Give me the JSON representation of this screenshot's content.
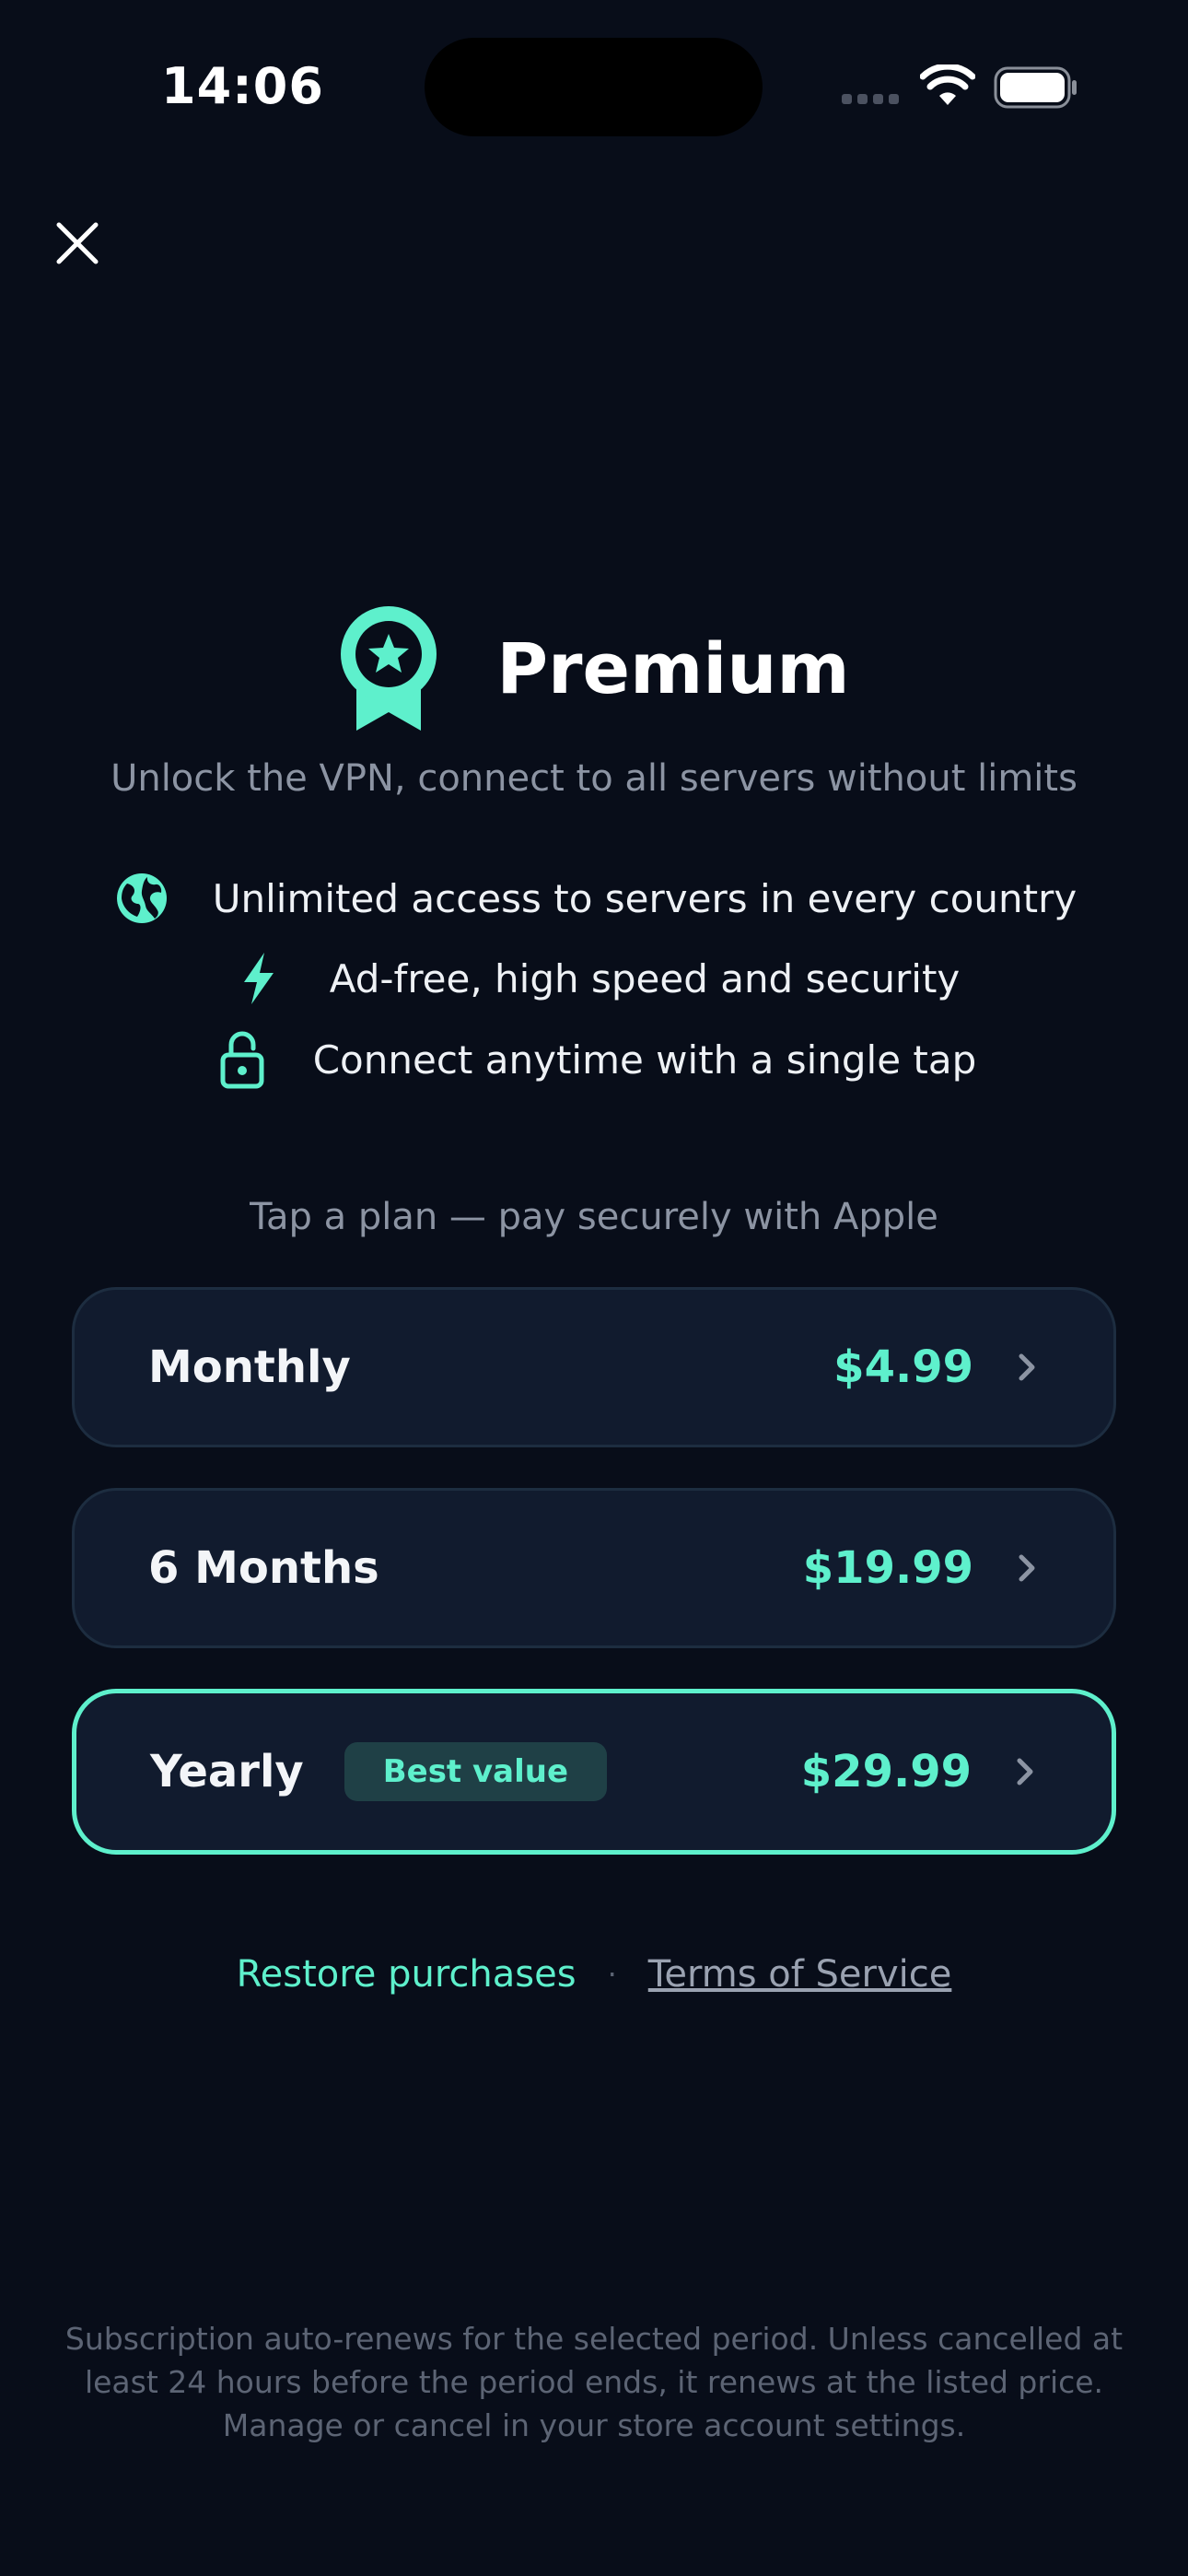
{
  "status_bar": {
    "time": "14:06"
  },
  "header": {
    "title": "Premium",
    "subtitle": "Unlock the VPN, connect to all servers without limits"
  },
  "features": [
    {
      "icon": "globe-icon",
      "text": "Unlimited access to servers in every country"
    },
    {
      "icon": "lightning-icon",
      "text": "Ad-free, high speed and security"
    },
    {
      "icon": "unlock-icon",
      "text": "Connect anytime with a single tap"
    }
  ],
  "plan_hint": "Tap a plan — pay securely with Apple",
  "plans": [
    {
      "name": "Monthly",
      "price": "$4.99",
      "badge": ""
    },
    {
      "name": "6 Months",
      "price": "$19.99",
      "badge": ""
    },
    {
      "name": "Yearly",
      "price": "$29.99",
      "badge": "Best value"
    }
  ],
  "links": {
    "restore": "Restore purchases",
    "separator": "·",
    "terms": "Terms of Service"
  },
  "legal": "Subscription auto-renews for the selected period. Unless cancelled at least 24 hours before the period ends, it renews at the listed price. Manage or cancel in your store account settings.",
  "colors": {
    "background": "#080d19",
    "accent": "#5ef0cc",
    "card": "#111b2e"
  }
}
